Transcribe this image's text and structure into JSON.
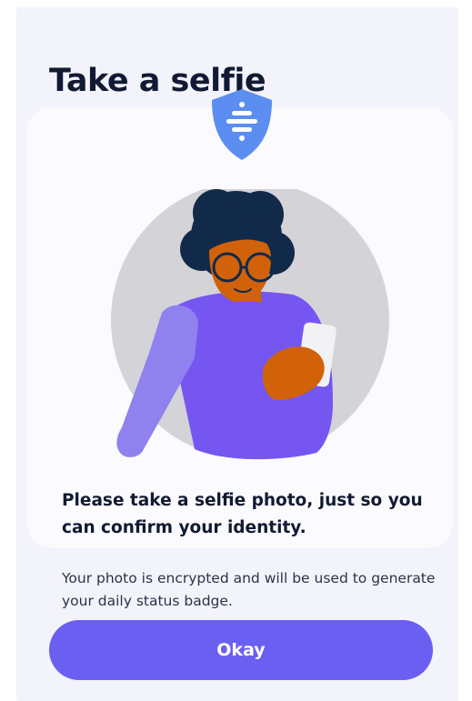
{
  "page": {
    "title": "Take a selfie"
  },
  "card": {
    "message": "Please take a selfie photo, just so you can confirm your identity.",
    "illustration_icon": "person-taking-selfie-illustration",
    "badge_icon": "shield-icon"
  },
  "info": {
    "text": "Your photo is encrypted and will be used to generate your daily status badge."
  },
  "actions": {
    "okay_label": "Okay"
  },
  "colors": {
    "accent": "#6b5ff2",
    "shield": "#5b8ef0",
    "title_text": "#121a33",
    "background": "#f3f3fb"
  }
}
